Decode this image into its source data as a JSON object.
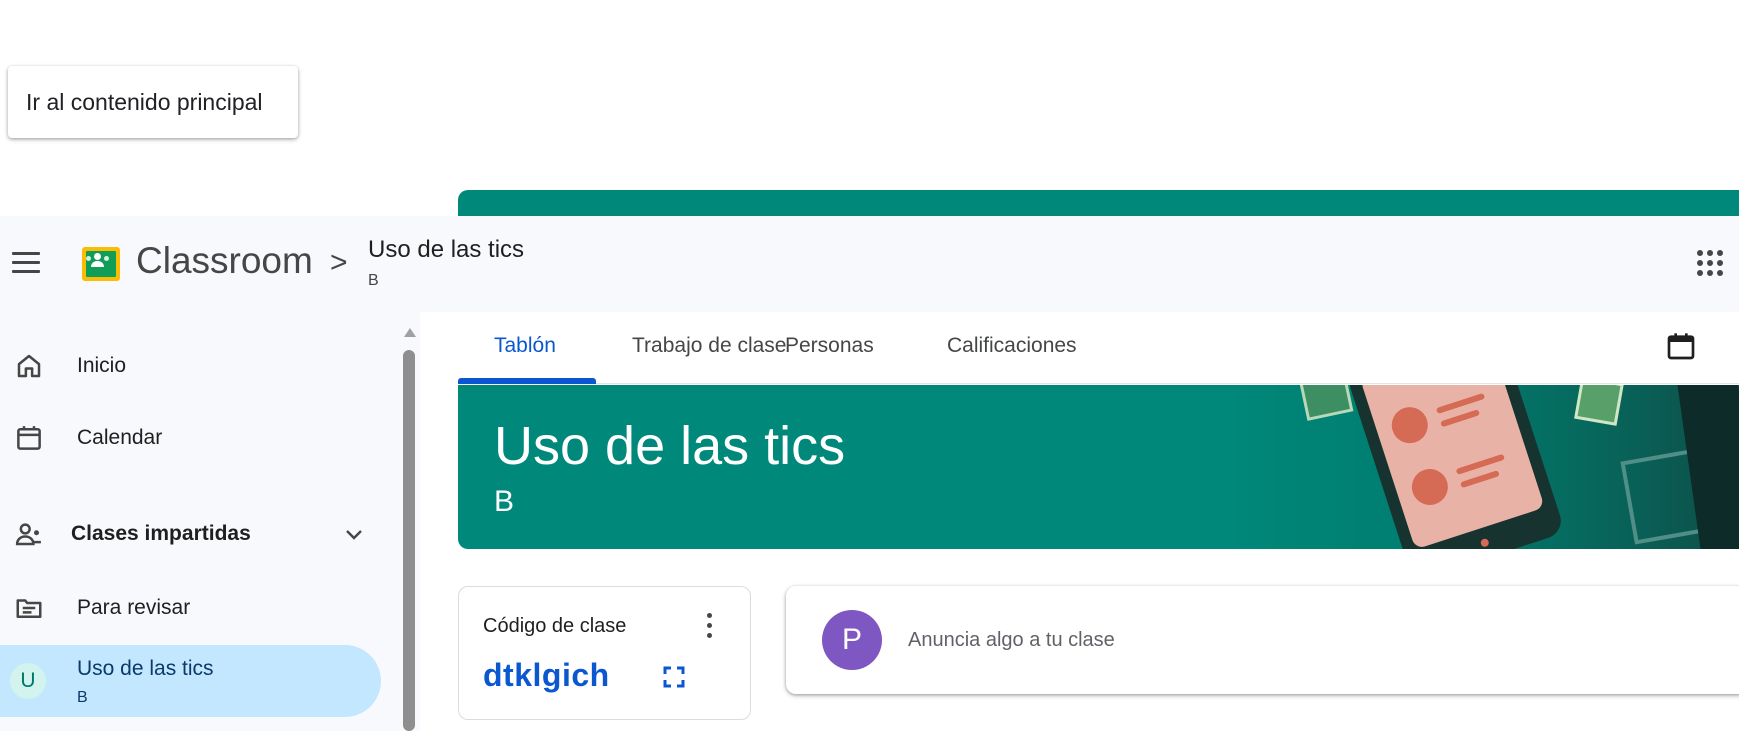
{
  "skip_link": {
    "label": "Ir al contenido principal"
  },
  "header": {
    "app_name": "Classroom",
    "breadcrumb_separator": ">",
    "class_title": "Uso de las tics",
    "class_section": "B"
  },
  "sidebar": {
    "items": [
      {
        "label": "Inicio",
        "icon": "home-icon"
      },
      {
        "label": "Calendar",
        "icon": "calendar-icon"
      },
      {
        "label": "Clases impartidas",
        "icon": "teaching-icon",
        "expandable": true
      },
      {
        "label": "Para revisar",
        "icon": "review-icon"
      },
      {
        "label": "Uso de las tics",
        "sub": "B",
        "avatar_letter": "U",
        "active": true
      }
    ]
  },
  "tabs": [
    {
      "label": "Tablón",
      "active": true
    },
    {
      "label": "Trabajo de clase"
    },
    {
      "label": "Personas"
    },
    {
      "label": "Calificaciones"
    }
  ],
  "hero": {
    "title": "Uso de las tics",
    "section": "B",
    "color": "#00897b"
  },
  "class_code": {
    "label": "Código de clase",
    "code": "dtklgich"
  },
  "announce": {
    "avatar_letter": "P",
    "placeholder": "Anuncia algo a tu clase",
    "avatar_color": "#7e57c2"
  },
  "colors": {
    "accent": "#0b57d0",
    "active_nav_bg": "#c2e7ff",
    "header_bg": "#f8f9fc"
  }
}
